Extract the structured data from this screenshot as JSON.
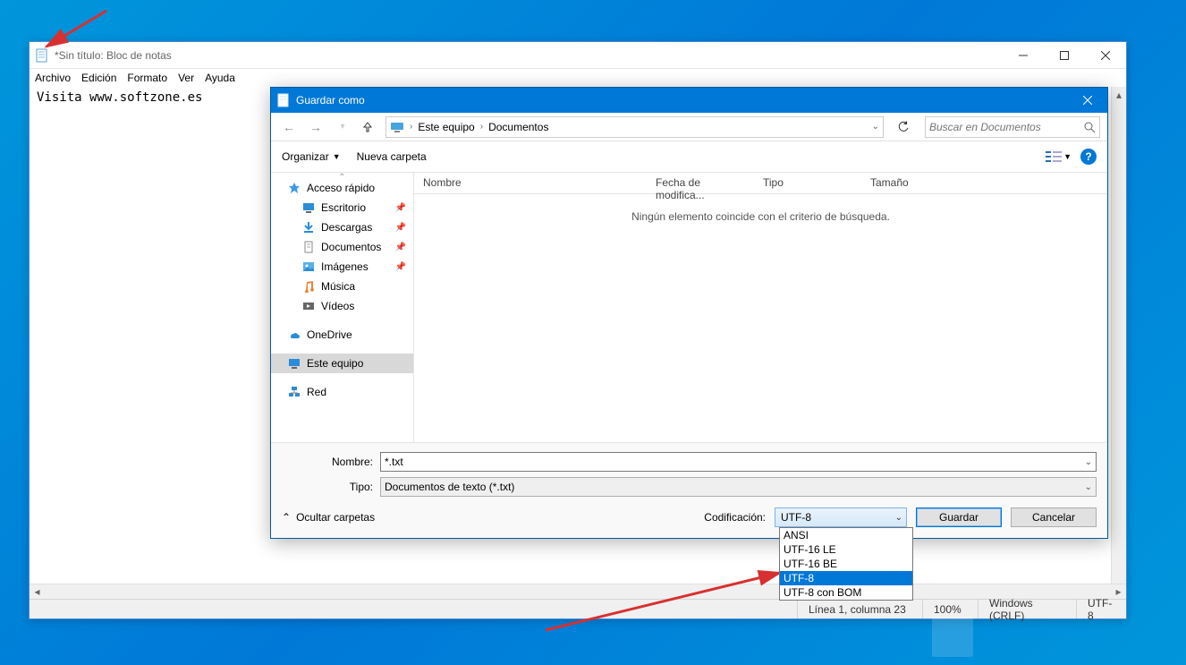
{
  "notepad": {
    "title": "*Sin título: Bloc de notas",
    "menu": {
      "file": "Archivo",
      "edit": "Edición",
      "format": "Formato",
      "view": "Ver",
      "help": "Ayuda"
    },
    "body": "Visita www.softzone.es",
    "status": {
      "pos": "Línea 1, columna 23",
      "zoom": "100%",
      "eol": "Windows (CRLF)",
      "encoding": "UTF-8"
    }
  },
  "dialog": {
    "title": "Guardar como",
    "breadcrumb": {
      "root": "Este equipo",
      "current": "Documentos"
    },
    "search_placeholder": "Buscar en Documentos",
    "toolbar": {
      "organize": "Organizar",
      "newfolder": "Nueva carpeta"
    },
    "tree": {
      "quick": "Acceso rápido",
      "desktop": "Escritorio",
      "downloads": "Descargas",
      "documents": "Documentos",
      "pictures": "Imágenes",
      "music": "Música",
      "videos": "Vídeos",
      "onedrive": "OneDrive",
      "thispc": "Este equipo",
      "network": "Red"
    },
    "columns": {
      "name": "Nombre",
      "date": "Fecha de modifica...",
      "type": "Tipo",
      "size": "Tamaño"
    },
    "empty": "Ningún elemento coincide con el criterio de búsqueda.",
    "filename_label": "Nombre:",
    "filename_value": "*.txt",
    "type_label": "Tipo:",
    "type_value": "Documentos de texto (*.txt)",
    "hide_folders": "Ocultar carpetas",
    "encoding_label": "Codificación:",
    "encoding_value": "UTF-8",
    "encoding_options": {
      "o0": "ANSI",
      "o1": "UTF-16 LE",
      "o2": "UTF-16 BE",
      "o3": "UTF-8",
      "o4": "UTF-8 con BOM"
    },
    "save": "Guardar",
    "cancel": "Cancelar"
  }
}
